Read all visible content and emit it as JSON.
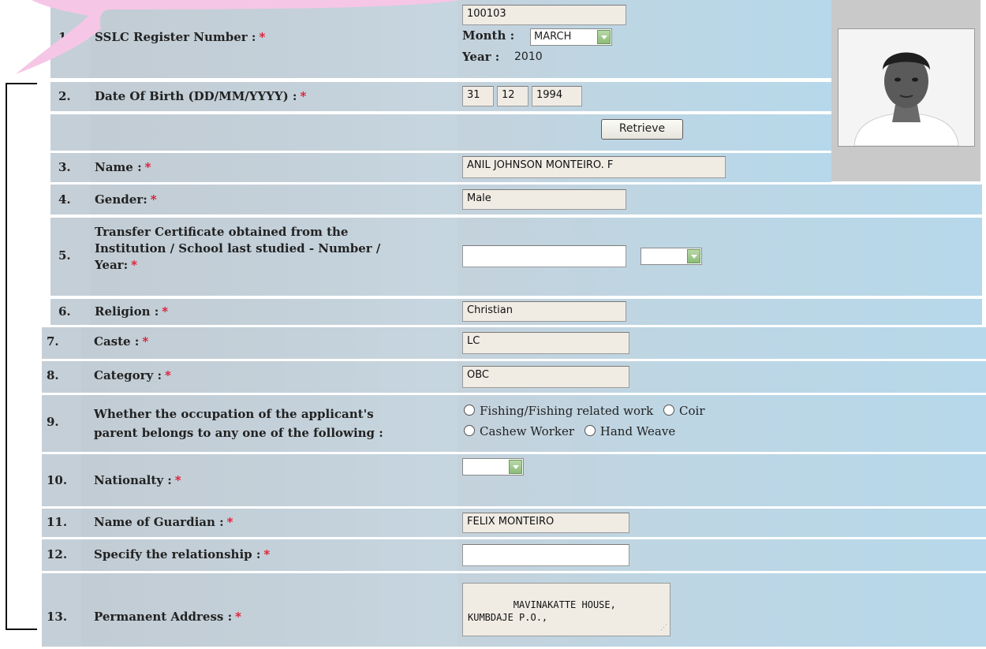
{
  "rows": [
    {
      "num": "1.",
      "label": "SSLC Register Number :",
      "value": "100103",
      "month_label": "Month :",
      "month_value": "MARCH",
      "year_label": "Year :",
      "year_value": "2010"
    },
    {
      "num": "2.",
      "label": "Date Of Birth (DD/MM/YYYY) :",
      "day": "31",
      "month": "12",
      "year": "1994"
    },
    {
      "retrieve_label": "Retrieve"
    },
    {
      "num": "3.",
      "label": "Name :",
      "value": "ANIL JOHNSON MONTEIRO. F"
    },
    {
      "num": "4.",
      "label": "Gender:",
      "value": "Male"
    },
    {
      "num": "5.",
      "label_lines": [
        "Transfer Certificate obtained from the",
        "Institution / School last studied - Number /",
        "Year:"
      ],
      "number_value": "",
      "year_value": ""
    },
    {
      "num": "6.",
      "label": "Religion :",
      "value": "Christian"
    },
    {
      "num": "7.",
      "label": "Caste :",
      "value": "LC"
    },
    {
      "num": "8.",
      "label": "Category :",
      "value": "OBC"
    },
    {
      "num": "9.",
      "label_lines": [
        "Whether the occupation of the applicant's",
        "parent belongs to any one of the following :"
      ],
      "options": [
        "Fishing/Fishing related work",
        "Coir",
        "Cashew Worker",
        "Hand Weave"
      ]
    },
    {
      "num": "10.",
      "label": "Nationalty :",
      "value": ""
    },
    {
      "num": "11.",
      "label": "Name of Guardian :",
      "value": "FELIX MONTEIRO"
    },
    {
      "num": "12.",
      "label": "Specify the relationship :",
      "value": ""
    },
    {
      "num": "13.",
      "label": "Permanent Address :",
      "value": "MAVINAKATTE HOUSE,\nKUMBDAJE P.O.,"
    }
  ],
  "required_mark": "*",
  "colors": {
    "required": "#e0102a",
    "callout": "#f6c6e6",
    "cell_blue": "#b6d8ea"
  }
}
